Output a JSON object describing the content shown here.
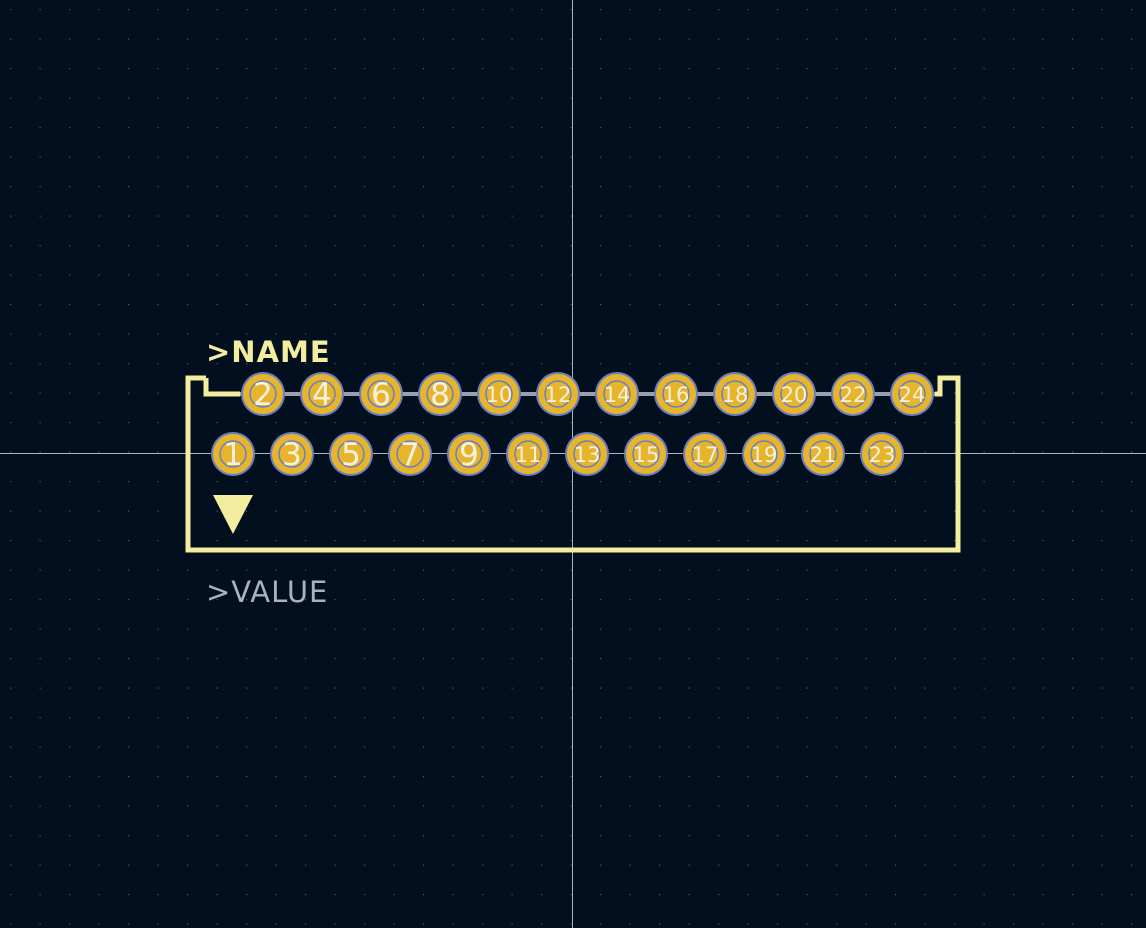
{
  "footprint": {
    "reference_text": ">NAME",
    "value_text": ">VALUE",
    "pads_top": [
      {
        "number": "2"
      },
      {
        "number": "4"
      },
      {
        "number": "6"
      },
      {
        "number": "8"
      },
      {
        "number": "10"
      },
      {
        "number": "12"
      },
      {
        "number": "14"
      },
      {
        "number": "16"
      },
      {
        "number": "18"
      },
      {
        "number": "20"
      },
      {
        "number": "22"
      },
      {
        "number": "24"
      }
    ],
    "pads_bottom": [
      {
        "number": "1"
      },
      {
        "number": "3"
      },
      {
        "number": "5"
      },
      {
        "number": "7"
      },
      {
        "number": "9"
      },
      {
        "number": "11"
      },
      {
        "number": "13"
      },
      {
        "number": "15"
      },
      {
        "number": "17"
      },
      {
        "number": "19"
      },
      {
        "number": "21"
      },
      {
        "number": "23"
      }
    ],
    "pin1_marker_icon": "triangle-down-icon"
  },
  "colors": {
    "background": "#020f1e",
    "grid_dot": "#4a5a70",
    "crosshair": "#c8d0dc",
    "silkscreen": "#f3eda0",
    "value_text": "#a9b2bd",
    "pad_fill": "#e6b52c",
    "pad_ring": "#6b7fc0",
    "pad_text": "#f5f0e0",
    "connect_line": "#9aa0b0"
  }
}
